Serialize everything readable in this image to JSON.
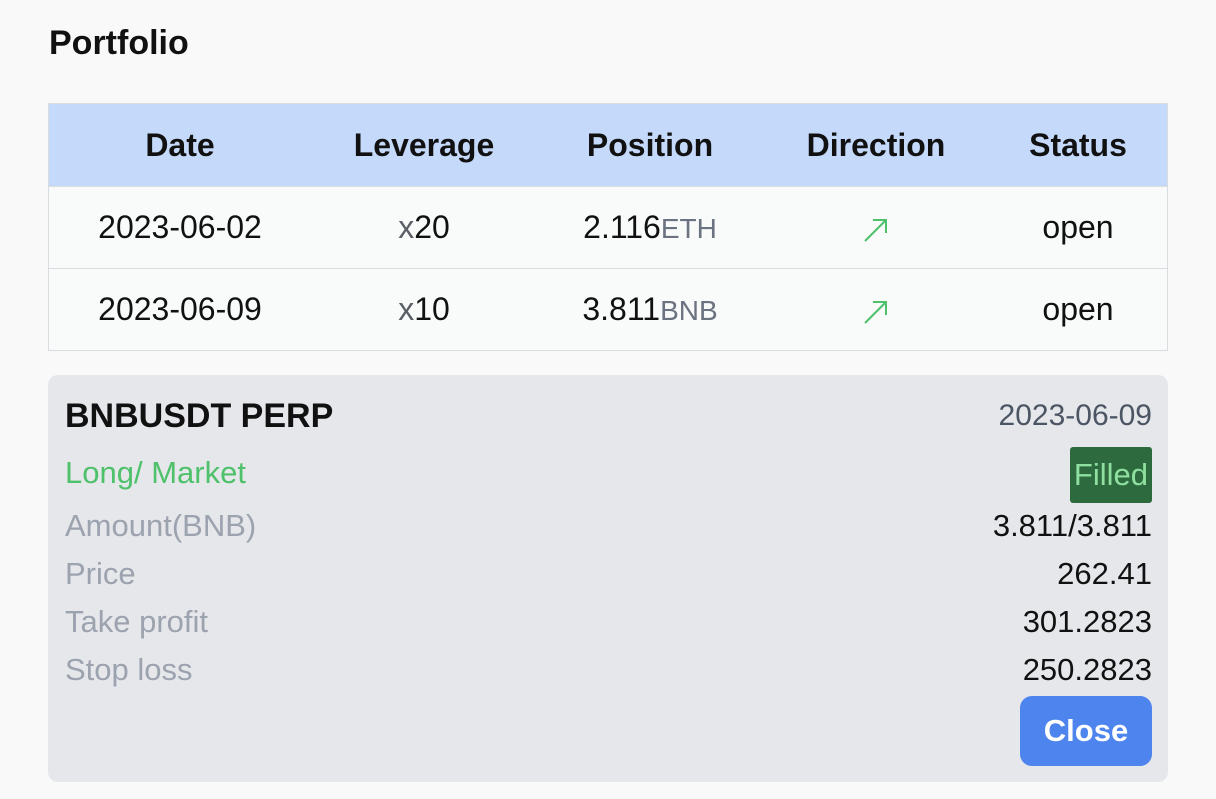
{
  "page": {
    "title": "Portfolio"
  },
  "table": {
    "headers": {
      "date": "Date",
      "leverage": "Leverage",
      "position": "Position",
      "direction": "Direction",
      "status": "Status"
    },
    "rows": [
      {
        "date": "2023-06-02",
        "leverage_prefix": "x",
        "leverage_value": "20",
        "position_amount": "2.116",
        "position_unit": "ETH",
        "direction_icon": "arrow-up-right-icon",
        "status": "open"
      },
      {
        "date": "2023-06-09",
        "leverage_prefix": "x",
        "leverage_value": "10",
        "position_amount": "3.811",
        "position_unit": "BNB",
        "direction_icon": "arrow-up-right-icon",
        "status": "open"
      }
    ]
  },
  "order_card": {
    "symbol": "BNBUSDT PERP",
    "date": "2023-06-09",
    "side": "Long/ Market",
    "status": "Filled",
    "fields": {
      "amount_label": "Amount(BNB)",
      "amount_value": "3.811/3.811",
      "price_label": "Price",
      "price_value": "262.41",
      "take_profit_label": "Take profit",
      "take_profit_value": "301.2823",
      "stop_loss_label": "Stop loss",
      "stop_loss_value": "250.2823"
    },
    "close_label": "Close"
  },
  "colors": {
    "header_bg": "#c5d9fa",
    "long_green": "#4ec16a",
    "filled_bg": "#2d6a3e",
    "filled_text": "#8fe0a0",
    "close_button": "#4d84ed",
    "card_bg": "#e5e7eb"
  }
}
